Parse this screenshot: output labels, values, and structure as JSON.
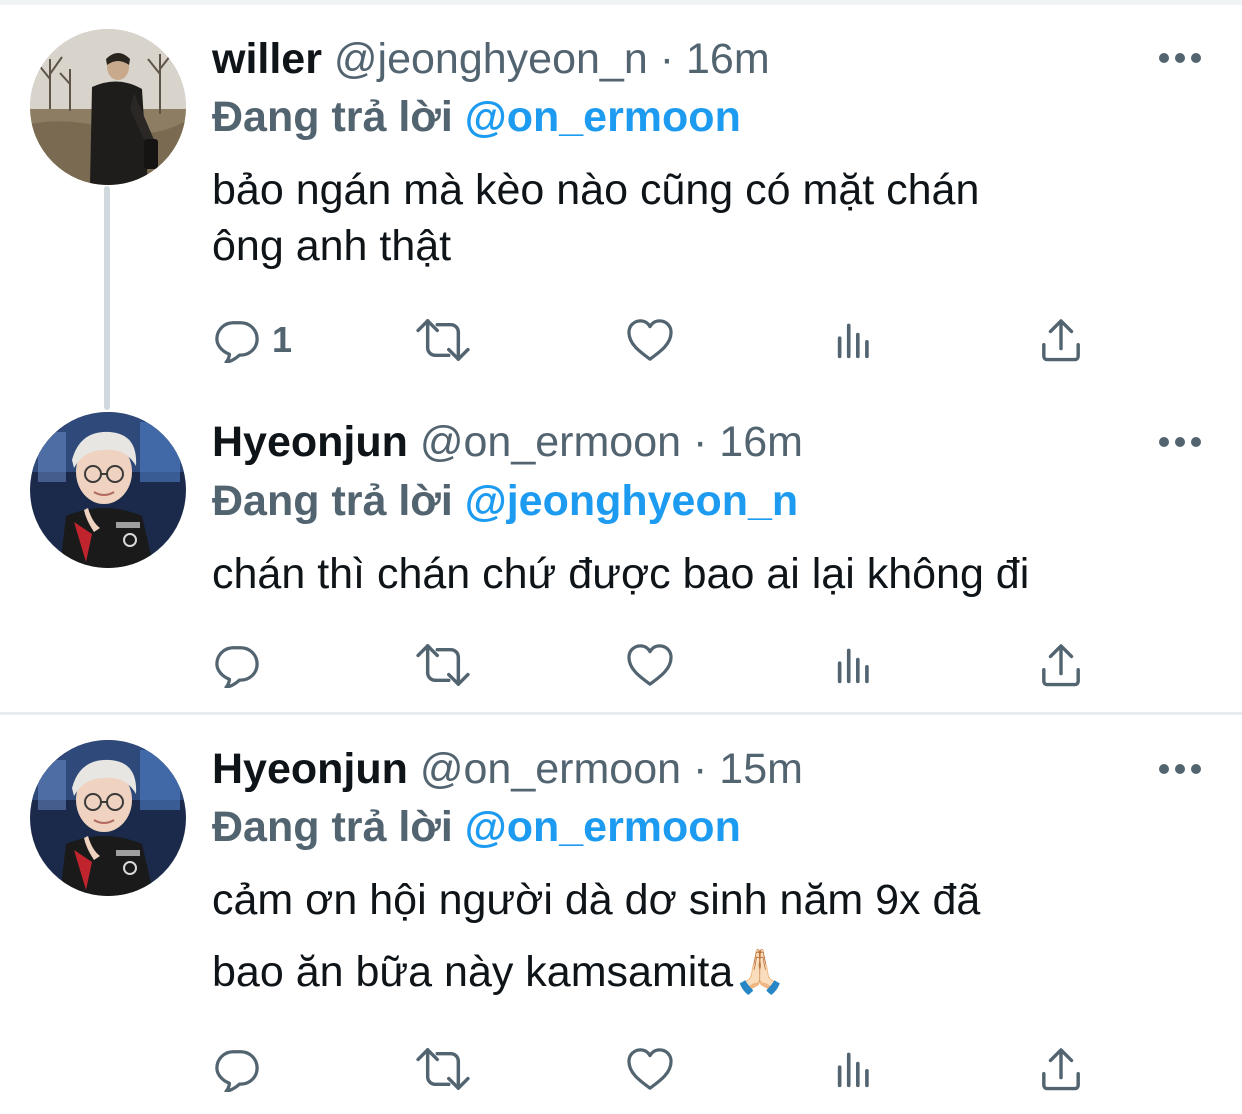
{
  "tweets": [
    {
      "display_name": "willer",
      "handle": "@jeonghyeon_n",
      "separator": "·",
      "time": "16m",
      "reply_prefix": "Đang trả lời",
      "reply_to": "@on_ermoon",
      "text_lines": [
        "bảo ngán mà kèo nào cũng có mặt chán",
        "ông anh thật"
      ],
      "reply_count": "1",
      "avatar_icon": "avatar-photo-willer"
    },
    {
      "display_name": "Hyeonjun",
      "handle": "@on_ermoon",
      "separator": "·",
      "time": "16m",
      "reply_prefix": "Đang trả lời",
      "reply_to": "@jeonghyeon_n",
      "text_lines": [
        "chán thì chán chứ được bao ai lại không đi"
      ],
      "reply_count": "",
      "avatar_icon": "avatar-photo-hyeonjun"
    },
    {
      "display_name": "Hyeonjun",
      "handle": "@on_ermoon",
      "separator": "·",
      "time": "15m",
      "reply_prefix": "Đang trả lời",
      "reply_to": "@on_ermoon",
      "text_lines": [
        "cảm ơn hội người dà dơ sinh năm 9x đã",
        "bao ăn bữa này kamsamita🙏🏻"
      ],
      "reply_count": "",
      "avatar_icon": "avatar-photo-hyeonjun"
    }
  ],
  "icons": {
    "more": "more-dots-icon",
    "reply": "reply-bubble-icon",
    "retweet": "retweet-icon",
    "like": "heart-icon",
    "views": "views-bar-chart-icon",
    "share": "share-upload-icon"
  },
  "colors": {
    "text_primary": "#0f1419",
    "text_secondary": "#536471",
    "accent": "#1d9bf0",
    "divider": "#e6ecf0",
    "thread_line": "#cfd9de"
  }
}
